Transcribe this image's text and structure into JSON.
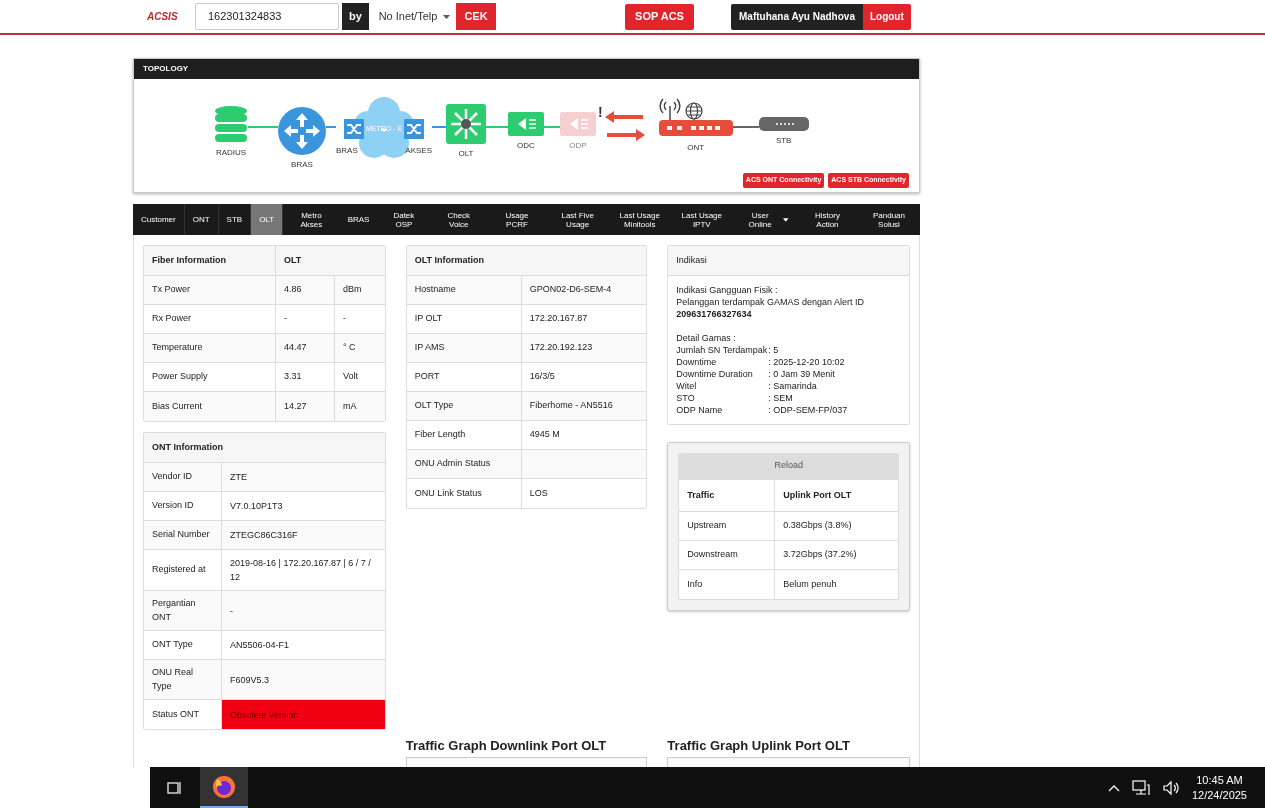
{
  "header": {
    "logo": "ACSIS",
    "search_value": "162301324833",
    "by": "by",
    "select": "No Inet/Telp",
    "cek": "CEK",
    "sop": "SOP ACS",
    "user": "Maftuhana Ayu Nadhova",
    "logout": "Logout"
  },
  "topology": {
    "title": "TOPOLOGY",
    "cloud_label": "METRO - E",
    "alert_mark": "!",
    "nodes": [
      {
        "kind": "database",
        "label": "RADIUS",
        "active": true
      },
      {
        "kind": "router",
        "label": "BRAS",
        "active": true
      },
      {
        "kind": "metro",
        "label": "BRAS",
        "label_2": "AKSES",
        "active": true
      },
      {
        "kind": "olt",
        "label": "OLT",
        "active": true
      },
      {
        "kind": "splitter",
        "label": "ODC",
        "active": true
      },
      {
        "kind": "splitter",
        "label": "ODP",
        "active": false
      },
      {
        "kind": "ont",
        "label": "ONT",
        "active": true
      },
      {
        "kind": "stb",
        "label": "STB",
        "active": true
      }
    ],
    "links": [
      "ACS ONT Connectivity",
      "ACS STB Connectivity"
    ]
  },
  "tabs": [
    {
      "label": "Customer",
      "selected": false,
      "dropdown": false
    },
    {
      "label": "ONT",
      "selected": false,
      "dropdown": false
    },
    {
      "label": "STB",
      "selected": false,
      "dropdown": false
    },
    {
      "label": "OLT",
      "selected": true,
      "dropdown": false
    },
    {
      "label": "Metro Akses",
      "selected": false,
      "dropdown": false
    },
    {
      "label": "BRAS",
      "selected": false,
      "dropdown": false
    },
    {
      "label": "Datek OSP",
      "selected": false,
      "dropdown": false
    },
    {
      "label": "Check Voice",
      "selected": false,
      "dropdown": false
    },
    {
      "label": "Usage PCRF",
      "selected": false,
      "dropdown": false
    },
    {
      "label": "Last Five Usage",
      "selected": false,
      "dropdown": false
    },
    {
      "label": "Last Usage Minitools",
      "selected": false,
      "dropdown": false
    },
    {
      "label": "Last Usage IPTV",
      "selected": false,
      "dropdown": false
    },
    {
      "label": "User Online",
      "selected": false,
      "dropdown": true
    },
    {
      "label": "History Action",
      "selected": false,
      "dropdown": false
    },
    {
      "label": "Panduan Solusi",
      "selected": false,
      "dropdown": false
    }
  ],
  "fiber": {
    "columns": [
      "Fiber Information",
      "OLT"
    ],
    "rows": [
      {
        "label": "Tx Power",
        "value": "4.86",
        "unit": "dBm"
      },
      {
        "label": "Rx Power",
        "value": "-",
        "unit": "-"
      },
      {
        "label": "Temperature",
        "value": "44.47",
        "unit": "° C"
      },
      {
        "label": "Power Supply",
        "value": "3.31",
        "unit": "Volt"
      },
      {
        "label": "Bias Current",
        "value": "14.27",
        "unit": "mA"
      }
    ]
  },
  "ont_info": {
    "title": "ONT Information",
    "rows": [
      {
        "label": "Vendor ID",
        "value": "ZTE",
        "alert": false
      },
      {
        "label": "Version ID",
        "value": "V7.0.10P1T3",
        "alert": false
      },
      {
        "label": "Serial Number",
        "value": "ZTEGC86C316F",
        "alert": false
      },
      {
        "label": "Registered at",
        "value": "2019-08-16 | 172.20.167.87 | 6 / 7 / 12",
        "alert": false
      },
      {
        "label": "Pergantian ONT",
        "value": "-",
        "alert": false
      },
      {
        "label": "ONT Type",
        "value": "AN5506-04-F1",
        "alert": false
      },
      {
        "label": "ONU Real Type",
        "value": "F609V5.3",
        "alert": false
      },
      {
        "label": "Status ONT",
        "value": "Obsolete Version",
        "alert": true
      }
    ]
  },
  "olt_info": {
    "title": "OLT Information",
    "rows": [
      {
        "label": "Hostname",
        "value": "GPON02-D6-SEM-4"
      },
      {
        "label": "IP OLT",
        "value": "172.20.167.87"
      },
      {
        "label": "IP AMS",
        "value": "172.20.192.123"
      },
      {
        "label": "PORT",
        "value": "16/3/5"
      },
      {
        "label": "OLT Type",
        "value": "Fiberhome - AN5516"
      },
      {
        "label": "Fiber Length",
        "value": "4945 M"
      },
      {
        "label": "ONU Admin Status"
      },
      {
        "label": "ONU Link Status",
        "value": "LOS"
      }
    ]
  },
  "indikasi": {
    "title": "Indikasi",
    "heading": "Indikasi Gangguan Fisik :",
    "text": "Pelanggan terdampak GAMAS dengan Alert ID",
    "alert_id": "209631766327634",
    "detail_title": "Detail Gamas :",
    "details": [
      {
        "label": "Jumlah SN Terdampak",
        "value": ": 5"
      },
      {
        "label": "Downtime",
        "value": ": 2025-12-20 10:02"
      },
      {
        "label": "Downtime Duration",
        "value": ": 0 Jam 39 Menit"
      },
      {
        "label": "Witel",
        "value": ": Samarinda"
      },
      {
        "label": "STO",
        "value": ": SEM"
      },
      {
        "label": "ODP Name",
        "value": ": ODP-SEM-FP/037"
      }
    ]
  },
  "traffic": {
    "reload": "Reload",
    "columns": [
      "Traffic",
      "Uplink Port OLT"
    ],
    "rows": [
      {
        "label": "Upstream",
        "value": "0.38Gbps (3.8%)"
      },
      {
        "label": "Downstream",
        "value": "3.72Gbps (37.2%)"
      },
      {
        "label": "Info",
        "value": "Belum penuh"
      }
    ]
  },
  "graphs": [
    "Traffic Graph Downlink Port OLT",
    "Traffic Graph Uplink Port OLT"
  ],
  "taskbar": {
    "time": "10:45 AM",
    "date": "12/24/2025"
  }
}
